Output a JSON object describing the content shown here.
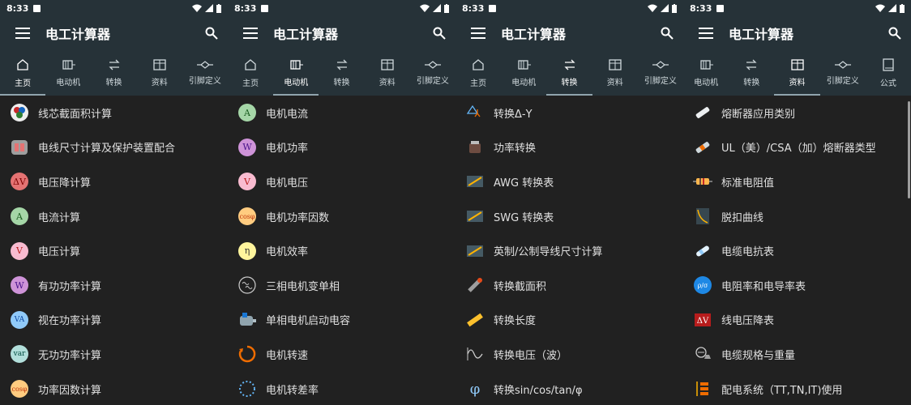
{
  "status_time": "8:33",
  "app_title": "电工计算器",
  "panels": [
    {
      "tabs": [
        {
          "label": "主页",
          "icon": "home-icon"
        },
        {
          "label": "电动机",
          "icon": "motor-icon"
        },
        {
          "label": "转换",
          "icon": "swap-icon"
        },
        {
          "label": "资料",
          "icon": "table-icon"
        },
        {
          "label": "引脚定义",
          "icon": "pinout-icon"
        }
      ],
      "items": [
        "线芯截面积计算",
        "电线尺寸计算及保护装置配合",
        "电压降计算",
        "电流计算",
        "电压计算",
        "有功功率计算",
        "视在功率计算",
        "无功功率计算",
        "功率因数计算"
      ]
    },
    {
      "tabs": [
        {
          "label": "主页",
          "icon": "home-icon"
        },
        {
          "label": "电动机",
          "icon": "motor-icon"
        },
        {
          "label": "转换",
          "icon": "swap-icon"
        },
        {
          "label": "资料",
          "icon": "table-icon"
        },
        {
          "label": "引脚定义",
          "icon": "pinout-icon"
        }
      ],
      "items": [
        "电机电流",
        "电机功率",
        "电机电压",
        "电机功率因数",
        "电机效率",
        "三相电机变单相",
        "单相电机启动电容",
        "电机转速",
        "电机转差率"
      ]
    },
    {
      "tabs": [
        {
          "label": "主页",
          "icon": "home-icon"
        },
        {
          "label": "电动机",
          "icon": "motor-icon"
        },
        {
          "label": "转换",
          "icon": "swap-icon"
        },
        {
          "label": "资料",
          "icon": "table-icon"
        },
        {
          "label": "引脚定义",
          "icon": "pinout-icon"
        }
      ],
      "items": [
        "转换Δ-Y",
        "功率转换",
        "AWG 转换表",
        "SWG 转换表",
        "英制/公制导线尺寸计算",
        "转换截面积",
        "转换长度",
        "转换电压（波）",
        "转换sin/cos/tan/φ"
      ]
    },
    {
      "tabs": [
        {
          "label": "电动机",
          "icon": "motor-icon"
        },
        {
          "label": "转换",
          "icon": "swap-icon"
        },
        {
          "label": "资料",
          "icon": "table-icon"
        },
        {
          "label": "引脚定义",
          "icon": "pinout-icon"
        },
        {
          "label": "公式",
          "icon": "book-icon"
        }
      ],
      "items": [
        "熔断器应用类别",
        "UL（美）/CSA（加）熔断器类型",
        "标准电阻值",
        "脱扣曲线",
        "电缆电抗表",
        "电阻率和电导率表",
        "线电压降表",
        "电缆规格与重量",
        "配电系统（TT,TN,IT)使用"
      ]
    }
  ],
  "icon_glyphs": {
    "motor": [
      "A",
      "W",
      "V",
      "cosφ",
      "η"
    ],
    "home": [
      "A",
      "V",
      "W",
      "VA",
      "var",
      "cosφ",
      "ΔV"
    ]
  }
}
